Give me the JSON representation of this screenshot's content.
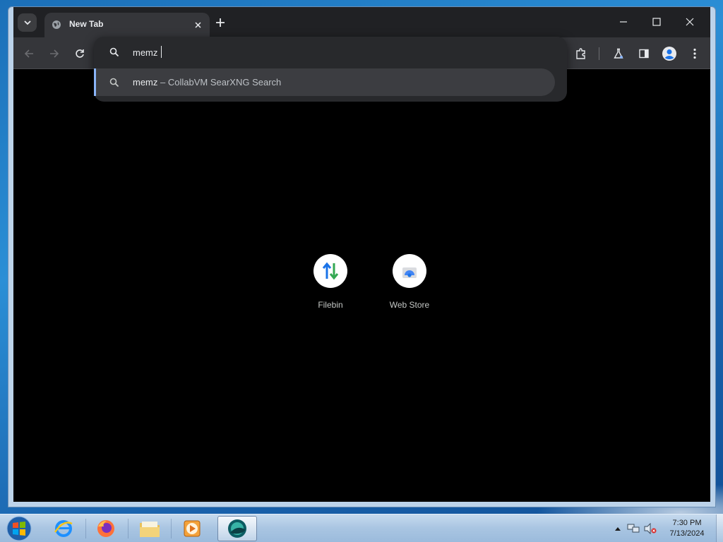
{
  "browser": {
    "tab": {
      "title": "New Tab",
      "favicon": "globe-icon"
    },
    "controls": {
      "minimize_icon": "minimize-icon",
      "maximize_icon": "maximize-icon",
      "close_icon": "close-icon"
    }
  },
  "omnibox": {
    "value": "memz",
    "suggestions": [
      {
        "query": "memz",
        "separator": " – ",
        "engine": "CollabVM SearXNG Search",
        "icon": "search-icon"
      }
    ]
  },
  "shortcuts": [
    {
      "label": "Filebin",
      "icon": "filebin-icon"
    },
    {
      "label": "Web Store",
      "icon": "web-store-icon"
    }
  ],
  "taskbar": {
    "apps": [
      "internet-explorer",
      "firefox",
      "file-explorer",
      "media-player",
      "browser-active"
    ],
    "clock": {
      "time": "7:30 PM",
      "date": "7/13/2024"
    }
  },
  "colors": {
    "accent": "#8ab4f8",
    "tabstrip": "#202124",
    "toolbar": "#35363a",
    "omnibox": "#28292c",
    "suggestion_selected": "#3c3d41",
    "page_background": "#000000"
  }
}
